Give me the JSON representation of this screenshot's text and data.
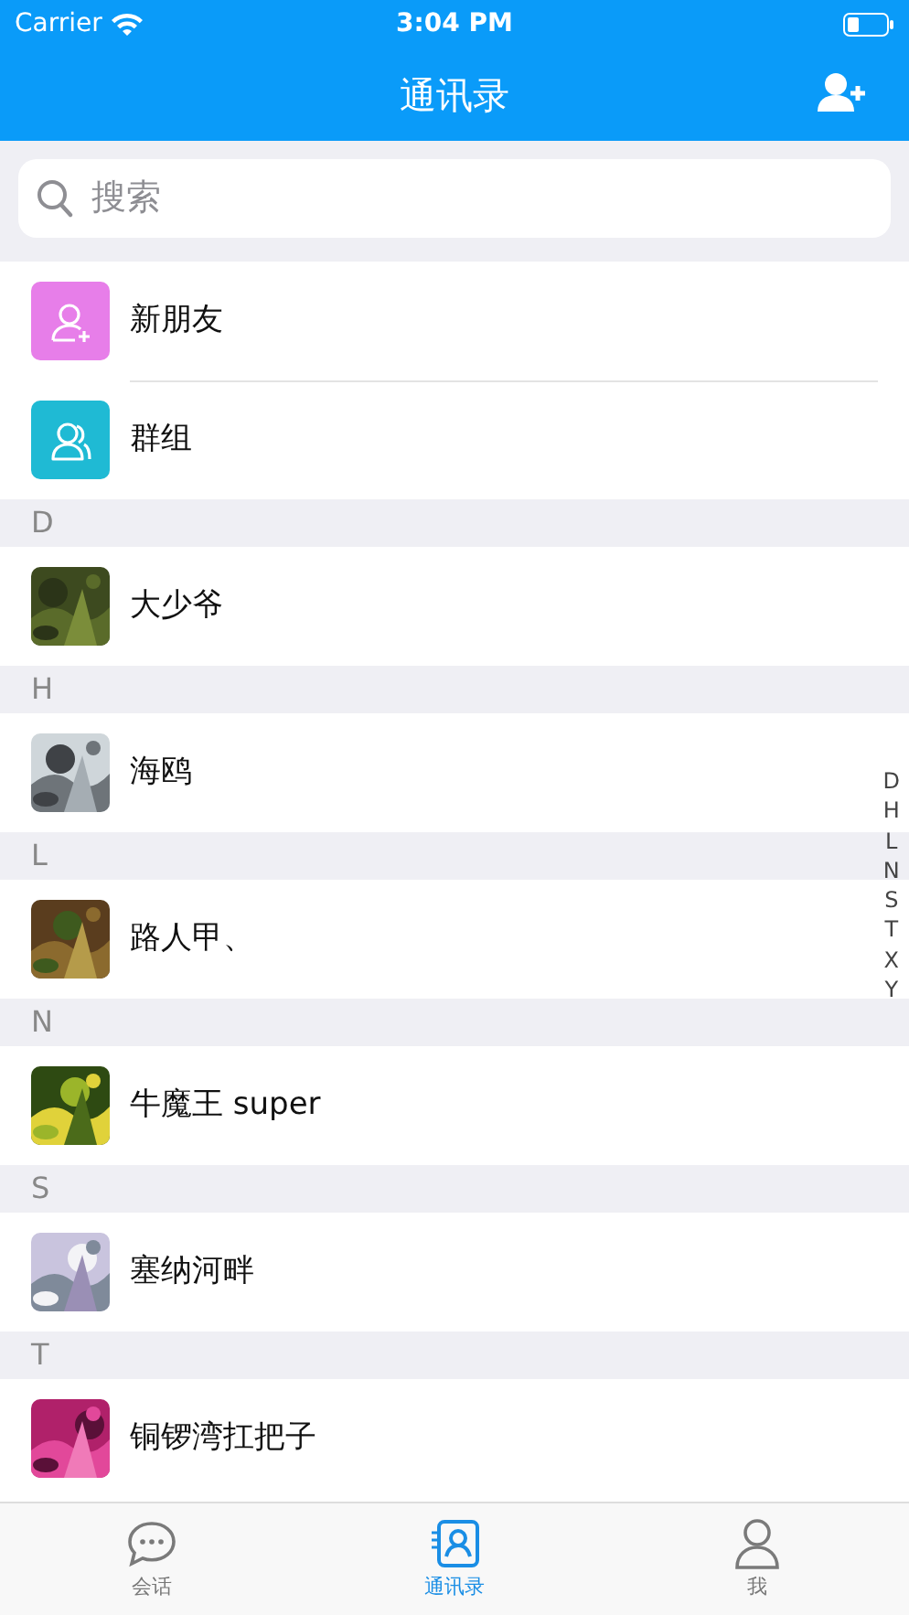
{
  "status_bar": {
    "carrier": "Carrier",
    "time": "3:04 PM"
  },
  "nav": {
    "title": "通讯录"
  },
  "search": {
    "placeholder": "搜索"
  },
  "shortcuts": [
    {
      "kind": "add-friend",
      "label": "新朋友",
      "color": "#e77ee9"
    },
    {
      "kind": "group",
      "label": "群组",
      "color": "#1fbad4"
    }
  ],
  "sections": [
    {
      "letter": "D",
      "contacts": [
        {
          "name": "大少爷"
        }
      ]
    },
    {
      "letter": "H",
      "contacts": [
        {
          "name": "海鸥"
        }
      ]
    },
    {
      "letter": "L",
      "contacts": [
        {
          "name": "路人甲、"
        }
      ]
    },
    {
      "letter": "N",
      "contacts": [
        {
          "name": "牛魔王 super"
        }
      ]
    },
    {
      "letter": "S",
      "contacts": [
        {
          "name": "塞纳河畔"
        }
      ]
    },
    {
      "letter": "T",
      "contacts": [
        {
          "name": "铜锣湾扛把子"
        }
      ]
    }
  ],
  "index_bar": [
    "D",
    "H",
    "L",
    "N",
    "S",
    "T",
    "X",
    "Y"
  ],
  "tab_bar": [
    {
      "kind": "chat",
      "label": "会话",
      "selected": false
    },
    {
      "kind": "contacts",
      "label": "通讯录",
      "selected": true
    },
    {
      "kind": "me",
      "label": "我",
      "selected": false
    }
  ]
}
